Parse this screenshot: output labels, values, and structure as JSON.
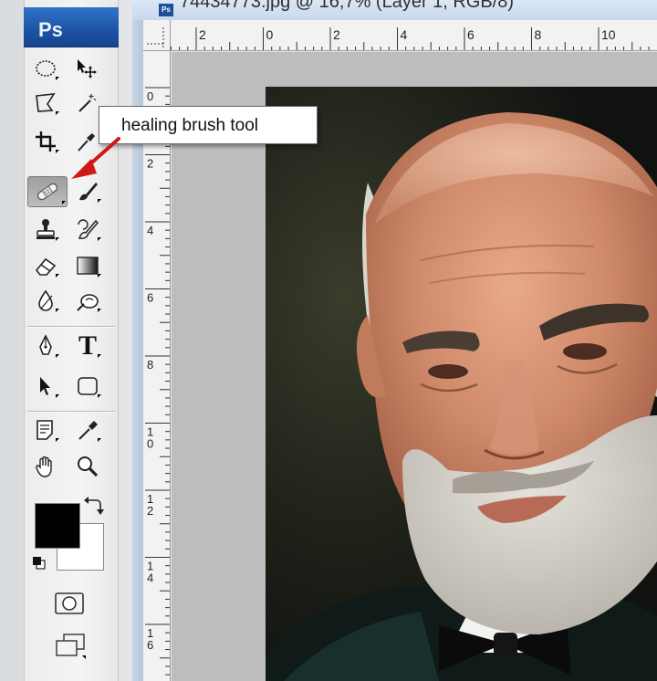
{
  "app": {
    "logo": "Ps"
  },
  "document": {
    "title": "74434773.jpg @ 16,7% (Layer 1, RGB/8)",
    "tab_icon": "Ps"
  },
  "rulers": {
    "horizontal_ticks": [
      "2",
      "0",
      "2",
      "4",
      "6",
      "8",
      "10"
    ],
    "vertical_ticks": [
      "0",
      "2",
      "4",
      "6",
      "8",
      "1\n0",
      "1\n2",
      "1\n4",
      "1\n6"
    ]
  },
  "callout": {
    "text": "healing brush tool"
  },
  "tools": [
    {
      "name": "elliptical-marquee-icon"
    },
    {
      "name": "move-icon"
    },
    {
      "name": "polygonal-lasso-icon"
    },
    {
      "name": "magic-wand-icon"
    },
    {
      "name": "crop-icon"
    },
    {
      "name": "eyedropper-icon"
    },
    {
      "name": "healing-brush-icon",
      "selected": true
    },
    {
      "name": "brush-icon"
    },
    {
      "name": "clone-stamp-icon"
    },
    {
      "name": "history-brush-icon"
    },
    {
      "name": "eraser-icon"
    },
    {
      "name": "gradient-icon"
    },
    {
      "name": "blur-icon"
    },
    {
      "name": "dodge-icon"
    },
    {
      "name": "pen-icon"
    },
    {
      "name": "type-icon"
    },
    {
      "name": "path-selection-icon"
    },
    {
      "name": "rectangle-shape-icon"
    },
    {
      "name": "notes-icon"
    },
    {
      "name": "color-sampler-icon"
    },
    {
      "name": "hand-icon"
    },
    {
      "name": "zoom-icon"
    }
  ],
  "colors": {
    "foreground": "#000000",
    "background": "#ffffff",
    "title_bar": "#1c53a2",
    "callout_arrow": "#d01818"
  },
  "type_tool_glyph": "T"
}
